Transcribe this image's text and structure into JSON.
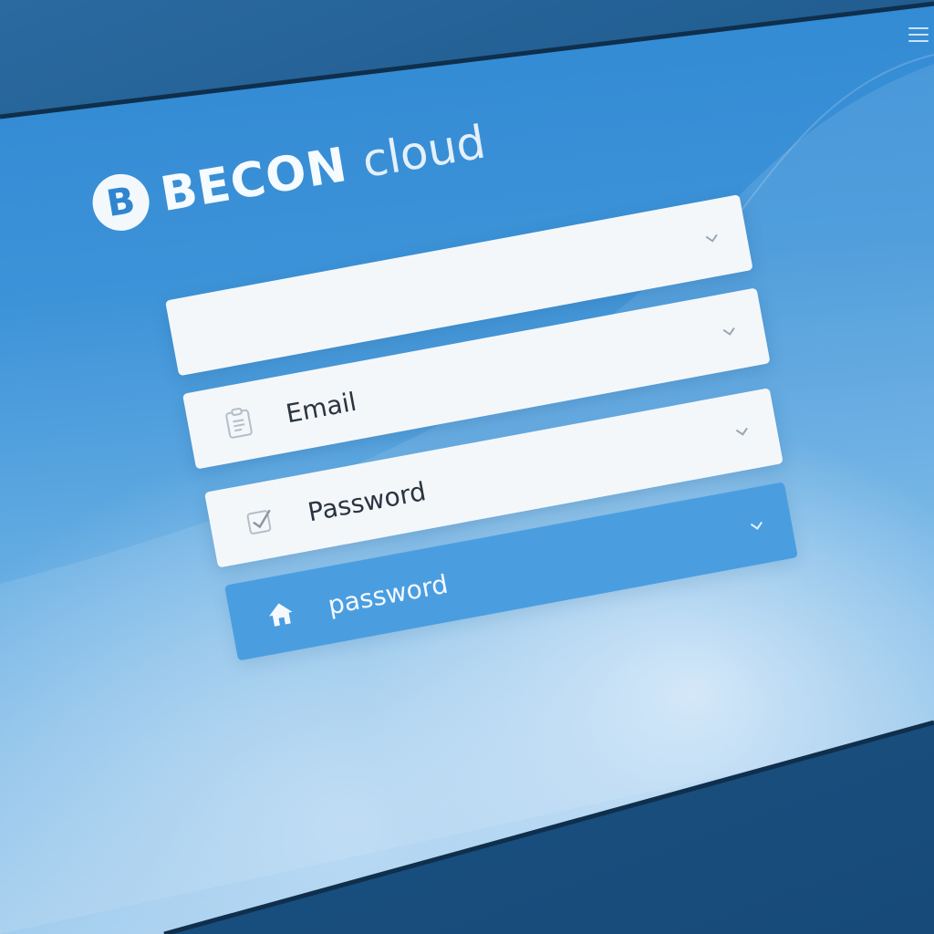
{
  "brand": {
    "logo_letter": "B",
    "name": "BECON",
    "suffix": "cloud"
  },
  "form": {
    "fields": [
      {
        "label": "Email",
        "icon": "clipboard-icon",
        "chevron": "chevron-down-icon"
      },
      {
        "label": "Password",
        "icon": "checkbox-icon",
        "chevron": "chevron-down-icon"
      },
      {
        "label": "password",
        "icon": "home-icon",
        "chevron": "chevron-down-icon"
      }
    ]
  },
  "header": {
    "menu_icon": "hamburger-menu-icon"
  },
  "colors": {
    "screen_blue": "#3d93d8",
    "accent_field": "#4a9ee0",
    "field_light": "#f4f7fa",
    "bezel": "#1b5486"
  }
}
